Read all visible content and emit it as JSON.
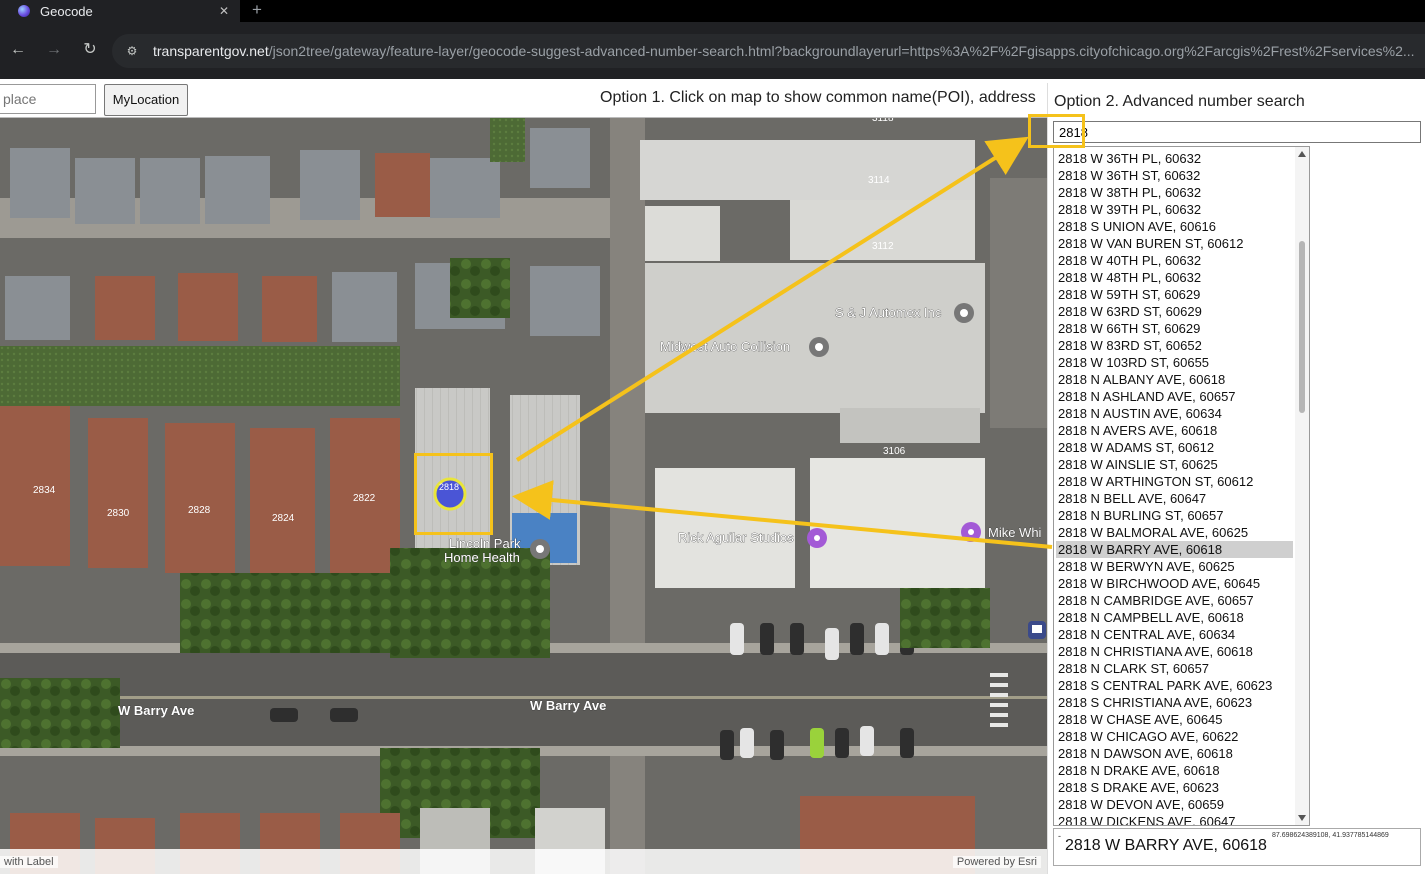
{
  "browser": {
    "tab_title": "Geocode",
    "new_tab": "+",
    "url_host": "transparentgov.net",
    "url_path": "/json2tree/gateway/feature-layer/geocode-suggest-advanced-number-search.html?backgroundlayerurl=https%3A%2F%2Fgisapps.cityofchicago.org%2Farcgis%2Frest%2Fservices%2..."
  },
  "toolbar": {
    "search_placeholder": "place",
    "mylocation_label": "MyLocation",
    "option1_text": "Option 1. Click on map to show common name(POI), address"
  },
  "map": {
    "labels": {
      "poi_sj": "S & J Automex Inc",
      "poi_midwest": "Midwest Auto Collision",
      "poi_rick": "Rick Aguilar Studios",
      "poi_mike": "Mike Whi",
      "poi_lincoln_1": "Lincoln Park",
      "poi_lincoln_2": "Home Health",
      "street_1": "W Barry Ave",
      "street_2": "W Barry Ave",
      "marker_number": "2818",
      "bldg_3114": "3114",
      "bldg_3112": "3112",
      "bldg_3106": "3106",
      "bldg_3118": "3118",
      "bldg_2834": "2834",
      "bldg_2830": "2830",
      "bldg_2828": "2828",
      "bldg_2824": "2824",
      "bldg_2822": "2822"
    },
    "footer_left": "with Label",
    "footer_right": "Powered by Esri"
  },
  "panel": {
    "option2_text": "Option 2. Advanced number search",
    "input_value": "2818",
    "results": [
      "2818 W 36TH PL, 60632",
      "2818 W 36TH ST, 60632",
      "2818 W 38TH PL, 60632",
      "2818 W 39TH PL, 60632",
      "2818 S UNION AVE, 60616",
      "2818 W VAN BUREN ST, 60612",
      "2818 W 40TH PL, 60632",
      "2818 W 48TH PL, 60632",
      "2818 W 59TH ST, 60629",
      "2818 W 63RD ST, 60629",
      "2818 W 66TH ST, 60629",
      "2818 W 83RD ST, 60652",
      "2818 W 103RD ST, 60655",
      "2818 N ALBANY AVE, 60618",
      "2818 N ASHLAND AVE, 60657",
      "2818 N AUSTIN AVE, 60634",
      "2818 N AVERS AVE, 60618",
      "2818 W ADAMS ST, 60612",
      "2818 W AINSLIE ST, 60625",
      "2818 W ARTHINGTON ST, 60612",
      "2818 N BELL AVE, 60647",
      "2818 N BURLING ST, 60657",
      "2818 W BALMORAL AVE, 60625",
      "2818 W BARRY AVE, 60618",
      "2818 W BERWYN AVE, 60625",
      "2818 W BIRCHWOOD AVE, 60645",
      "2818 N CAMBRIDGE AVE, 60657",
      "2818 N CAMPBELL AVE, 60618",
      "2818 N CENTRAL AVE, 60634",
      "2818 N CHRISTIANA AVE, 60618",
      "2818 N CLARK ST, 60657",
      "2818 S CENTRAL PARK AVE, 60623",
      "2818 S CHRISTIANA AVE, 60623",
      "2818 W CHASE AVE, 60645",
      "2818 W CHICAGO AVE, 60622",
      "2818 N DAWSON AVE, 60618",
      "2818 N DRAKE AVE, 60618",
      "2818 S DRAKE AVE, 60623",
      "2818 W DEVON AVE, 60659",
      "2818 W DICKENS AVE, 60647"
    ],
    "selected_result": "2818 W BARRY AVE, 60618",
    "result_label": "2818 W BARRY AVE, 60618",
    "result_coords": "87.698624389108, 41.937785144869",
    "result_tick": "-"
  },
  "colors": {
    "annotation": "#f5c21b",
    "selected_row": "#cfcfcf",
    "marker_fill": "#4a55d6"
  }
}
